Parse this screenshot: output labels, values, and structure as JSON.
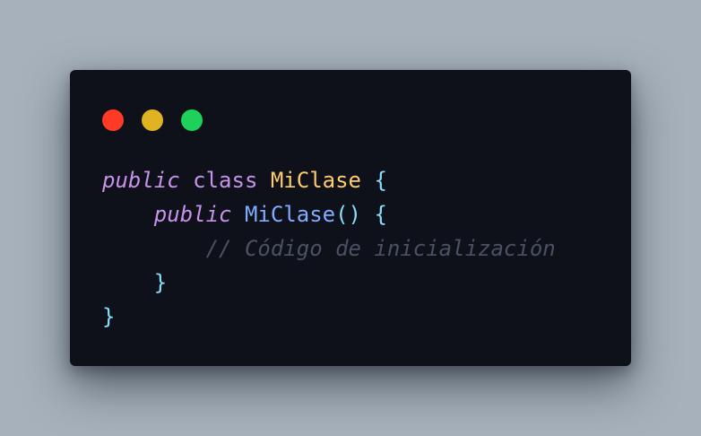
{
  "window": {
    "controls": {
      "close_color": "#ff3b27",
      "minimize_color": "#e1b322",
      "maximize_color": "#1ed15a"
    }
  },
  "code": {
    "line1": {
      "modifier": "public",
      "keyword": "class",
      "class_name": "MiClase",
      "brace": "{"
    },
    "line2": {
      "indent": "    ",
      "modifier": "public",
      "method_name": "MiClase",
      "parens": "()",
      "brace": "{"
    },
    "line3": {
      "indent": "        ",
      "comment": "// Código de inicialización"
    },
    "line4": {
      "indent": "    ",
      "brace": "}"
    },
    "line5": {
      "brace": "}"
    }
  }
}
